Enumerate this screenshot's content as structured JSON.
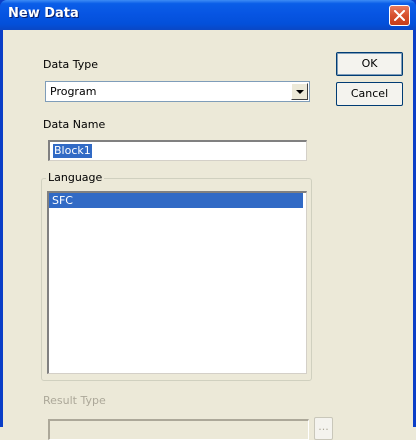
{
  "window": {
    "title": "New Data",
    "close_icon": "close-x-icon"
  },
  "form": {
    "data_type_label": "Data Type",
    "data_type_value": "Program",
    "data_name_label": "Data Name",
    "data_name_value": "Block1",
    "language_label": "Language",
    "language_items": [
      "SFC"
    ],
    "result_type_label": "Result Type",
    "result_type_value": "",
    "browse_label": "..."
  },
  "buttons": {
    "ok": "OK",
    "cancel": "Cancel"
  }
}
